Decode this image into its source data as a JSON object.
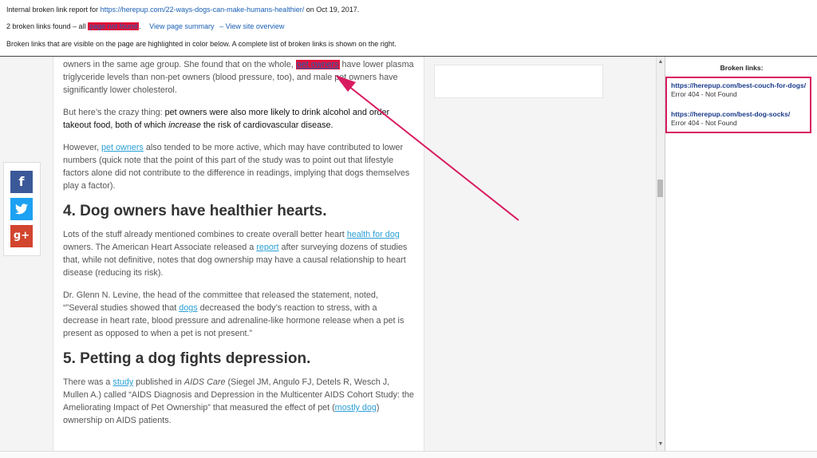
{
  "report": {
    "intro": "Internal broken link report for",
    "url": "https://herepup.com/22-ways-dogs-can-make-humans-healthier/",
    "date": "on Oct 19, 2017.",
    "found": "2 broken links found – all",
    "status_hl": "page not found",
    "found_end": ".",
    "view_summary": "View page summary",
    "view_overview": "– View site overview",
    "note": "Broken links that are visible on the page are highlighted in color below. A complete list of broken links is shown on the right."
  },
  "article": {
    "p1": {
      "a": "owners in the same age group. She found that on the whole,",
      "link": "pet owners",
      "b": "have lower plasma triglyceride levels than non-pet owners (blood pressure, too), and male pet owners have significantly lower cholesterol."
    },
    "p2": {
      "a": "But here’s the crazy thing:",
      "b": "pet owners were also more likely to drink alcohol and order takeout food, both of which",
      "c": "increase",
      "d": "the risk of cardiovascular disease."
    },
    "p3": {
      "a": "However,",
      "link": "pet owners",
      "b": "also tended to be more active, which may have contributed to lower numbers (quick note that the point of this part of the study was to point out that lifestyle factors alone did not contribute to the difference in readings, implying that dogs themselves play a factor)."
    },
    "h4": "4. Dog owners have healthier hearts.",
    "p4": {
      "a": "Lots of the stuff already mentioned combines to create overall better heart",
      "link1": "health for dog",
      "b": "owners. The American Heart Associate released a",
      "link2": "report",
      "c": "after surveying dozens of studies that, while not definitive, notes that dog ownership may have a causal relationship to heart disease (reducing its risk)."
    },
    "p5": {
      "a": "Dr. Glenn N. Levine, the head of the committee that released the statement, noted, “”Several studies showed that",
      "link": "dogs",
      "b": "decreased the body’s reaction to stress, with a decrease in heart rate, blood pressure and adrenaline-like hormone release when a pet is present as opposed to when a pet is not present.”"
    },
    "h5": "5. Petting a dog fights depression.",
    "p6": {
      "a": "There was a",
      "link1": "study",
      "b": "published in",
      "c": "AIDS Care",
      "d": "(Siegel JM, Angulo FJ, Detels R, Wesch J, Mullen A.) called “AIDS Diagnosis and Depression in the Multicenter AIDS Cohort Study: the Ameliorating Impact of Pet Ownership” that measured the effect of pet (",
      "link2": "mostly dog",
      "e": ") ownership on AIDS patients."
    }
  },
  "share": {
    "facebook_glyph": "f",
    "twitter_glyph": "🐦",
    "google_glyph": "g+"
  },
  "panel": {
    "title": "Broken links:",
    "links": [
      {
        "url": "https://herepup.com/best-couch-for-dogs/",
        "error": "Error 404 - Not Found"
      },
      {
        "url": "https://herepup.com/best-dog-socks/",
        "error": "Error 404 - Not Found"
      }
    ]
  },
  "colors": {
    "highlight": "#e0133a",
    "box_border": "#d81b60",
    "arrow": "#d81b60"
  }
}
